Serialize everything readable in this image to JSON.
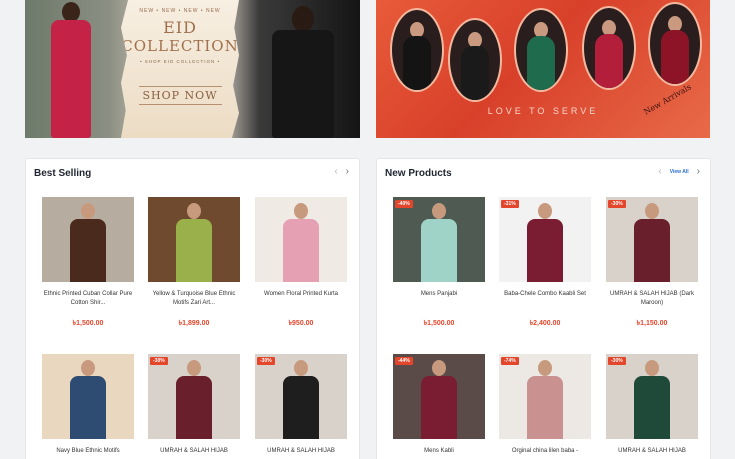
{
  "banners": {
    "left": {
      "new_tags": "NEW • NEW • NEW • NEW",
      "title_line1": "EID",
      "title_line2": "COLLECTION",
      "subtitle": "• SHOP EID COLLECTION •",
      "cta": "SHOP NOW"
    },
    "right": {
      "tagline": "LOVE TO SERVE",
      "badge": "New Arrivals"
    }
  },
  "best_selling": {
    "title": "Best Selling",
    "products": [
      {
        "name": "Ethnic Printed Cuban Collar Pure Cotton Shir...",
        "price": "৳1,500.00",
        "badge": "",
        "bg": "#b7aca0",
        "body": "#4a2a1c"
      },
      {
        "name": "Yellow & Turquoise Blue Ethnic Motifs Zari Art...",
        "price": "৳1,899.00",
        "badge": "",
        "bg": "#6f4a2e",
        "body": "#9ab04a"
      },
      {
        "name": "Women Floral Printed Kurta",
        "price": "৳950.00",
        "badge": "",
        "bg": "#efeae4",
        "body": "#e6a0b4"
      },
      {
        "name": "Navy Blue Ethnic Motifs",
        "price": "",
        "badge": "",
        "bg": "#e9d7c0",
        "body": "#2e4c72"
      },
      {
        "name": "UMRAH & SALAH HIJAB",
        "price": "",
        "badge": "-30%",
        "bg": "#d8d2cb",
        "body": "#6a1f2c"
      },
      {
        "name": "UMRAH & SALAH HIJAB",
        "price": "",
        "badge": "-30%",
        "bg": "#d8d2cb",
        "body": "#1e1e1e"
      }
    ]
  },
  "new_products": {
    "title": "New Products",
    "view_all": "View All",
    "products": [
      {
        "name": "Mens Panjabi",
        "price": "৳1,500.00",
        "badge": "-40%",
        "bg": "#4e5a52",
        "body": "#9fd3c8"
      },
      {
        "name": "Baba-Chele Combo Kaabli Set",
        "price": "৳2,400.00",
        "badge": "-31%",
        "bg": "#f2f2f2",
        "body": "#7a1d32"
      },
      {
        "name": "UMRAH & SALAH HIJAB (Dark Maroon)",
        "price": "৳1,150.00",
        "badge": "-30%",
        "bg": "#d8d2cb",
        "body": "#6a1f2c"
      },
      {
        "name": "Mens Kabli",
        "price": "",
        "badge": "-44%",
        "bg": "#5a4a48",
        "body": "#7a1d32"
      },
      {
        "name": "Orginal china lilen baba -",
        "price": "",
        "badge": "-74%",
        "bg": "#ece8e3",
        "body": "#c9918f"
      },
      {
        "name": "UMRAH & SALAH HIJAB",
        "price": "",
        "badge": "-30%",
        "bg": "#d8d2cb",
        "body": "#1f4a3a"
      }
    ]
  }
}
